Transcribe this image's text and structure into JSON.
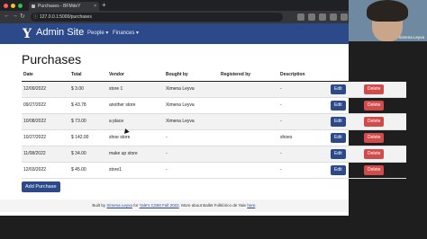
{
  "browser": {
    "tab_title": "Purchases - BFMdeY",
    "tab_close": "×",
    "new_tab": "+",
    "url": "127.0.0.1:5000/purchases",
    "colors": {
      "close": "#ff5f57",
      "min": "#febc2e",
      "max": "#28c840"
    }
  },
  "webcam": {
    "name": "Ximena Leyva"
  },
  "navbar": {
    "logo": "Y",
    "brand": "Admin Site",
    "menu": [
      {
        "label": "People ▾"
      },
      {
        "label": "Finances ▾"
      }
    ],
    "color": "#2c4a8a"
  },
  "page": {
    "title": "Purchases",
    "columns": [
      "Date",
      "Total",
      "Vendor",
      "Bought by",
      "Registered by",
      "Description",
      "",
      ""
    ],
    "rows": [
      {
        "date": "12/09/2022",
        "total": "$ 3.00",
        "vendor": "store 1",
        "bought_by": "Ximena Leyva",
        "registered_by": "",
        "description": "-"
      },
      {
        "date": "09/27/2022",
        "total": "$ 43.78",
        "vendor": "another store",
        "bought_by": "Ximena Leyva",
        "registered_by": "",
        "description": "-"
      },
      {
        "date": "10/08/2022",
        "total": "$ 73.00",
        "vendor": "a place",
        "bought_by": "Ximena Leyva",
        "registered_by": "",
        "description": "-"
      },
      {
        "date": "10/27/2022",
        "total": "$ 142.00",
        "vendor": "shoe store",
        "bought_by": "-",
        "registered_by": "",
        "description": "shoes"
      },
      {
        "date": "11/08/2022",
        "total": "$ 34.00",
        "vendor": "make up store",
        "bought_by": "-",
        "registered_by": "",
        "description": "-"
      },
      {
        "date": "12/03/2022",
        "total": "$ 45.00",
        "vendor": "store1",
        "bought_by": "-",
        "registered_by": "",
        "description": "-"
      }
    ],
    "edit_label": "Edit",
    "delete_label": "Delete",
    "add_label": "Add Purchase"
  },
  "footer": {
    "prefix": "Built by ",
    "author": "Ximena Leyva",
    "mid": " for ",
    "course": "Yale's CS50 Fall 2022",
    "suffix": ". More about Ballet Folklórico de Yale ",
    "link": "here",
    "end": "."
  }
}
